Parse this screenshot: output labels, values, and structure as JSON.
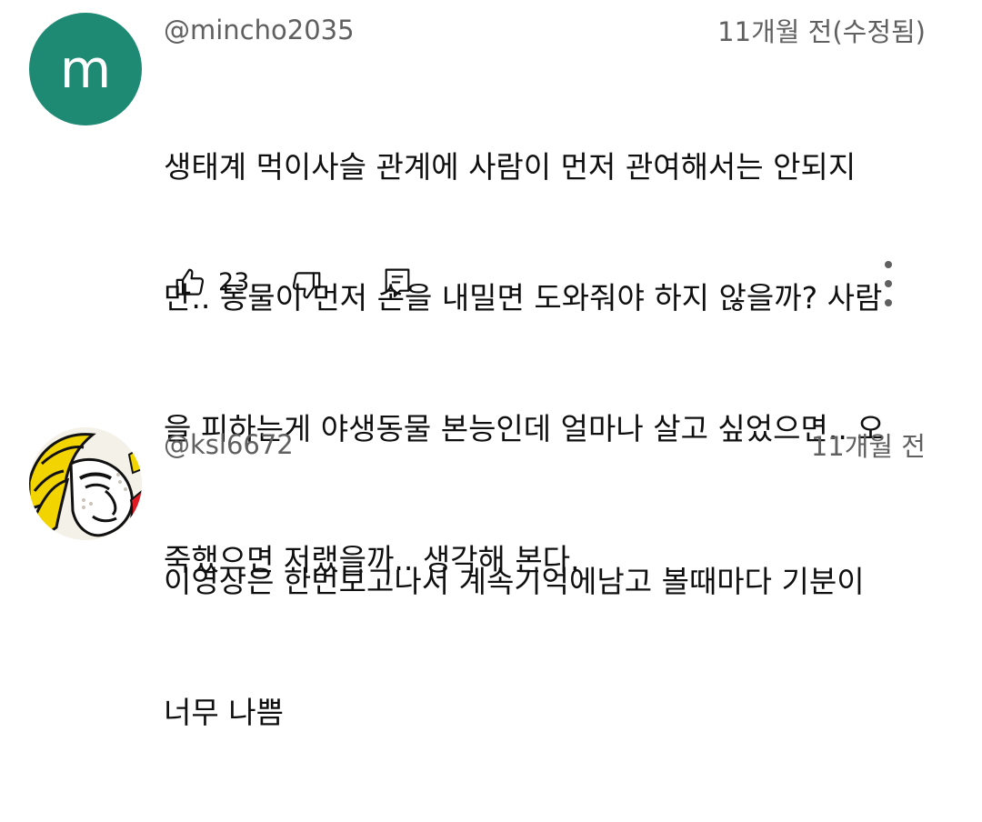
{
  "comments": [
    {
      "avatar": {
        "letter": "m",
        "bg": "#1e8a73"
      },
      "handle": "@mincho2035",
      "time": "11개월 전(수정됨)",
      "lines": [
        "생태계 먹이사슬 관계에 사람이 먼저 관여해서는 안되지",
        "만.. 동물이 먼저 손을 내밀면 도와줘야 하지 않을까? 사람",
        "을 피하는게 야생동물 본능인데 얼마나 살고 싶었으면.. 오",
        "죽했으면 저랬을까.. 생각해 본다."
      ],
      "actions": {
        "like_icon": "thumbs-up-icon",
        "like_count": "23",
        "dislike_icon": "thumbs-down-icon",
        "reply_icon": "reply-icon",
        "more_icon": "more-vert-icon"
      }
    },
    {
      "avatar": {
        "image": "pop-art-portrait"
      },
      "handle": "@ksl6672",
      "time": "11개월 전",
      "lines": [
        "이영상은 한번보고나서 계속기억에남고 볼때마다 기분이",
        "너무 나쁨"
      ]
    }
  ]
}
